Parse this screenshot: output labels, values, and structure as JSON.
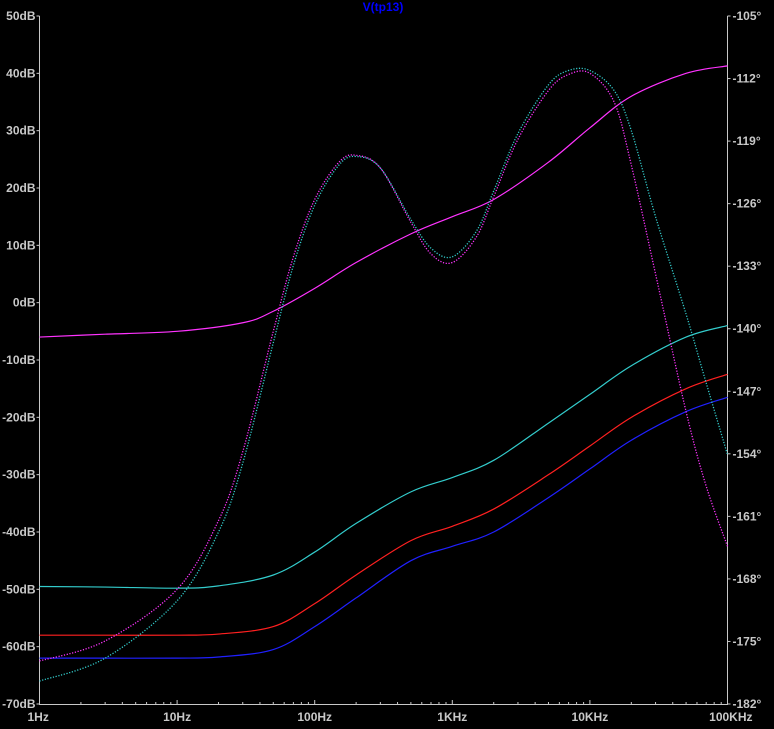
{
  "chart_data": {
    "type": "line",
    "title": "V(tp13)",
    "xscale": "log",
    "xlim": [
      1,
      100000
    ],
    "x_tick_labels": [
      "1Hz",
      "10Hz",
      "100Hz",
      "1KHz",
      "10KHz",
      "100KHz"
    ],
    "ylim_left": [
      -70,
      50
    ],
    "y_left_unit": "dB",
    "y_left_tick_labels": [
      "50dB",
      "40dB",
      "30dB",
      "20dB",
      "10dB",
      "0dB",
      "-10dB",
      "-20dB",
      "-30dB",
      "-40dB",
      "-50dB",
      "-60dB",
      "-70dB"
    ],
    "ylim_right": [
      -182,
      -105
    ],
    "y_right_unit": "degrees",
    "y_right_tick_labels": [
      "-105°",
      "-112°",
      "-119°",
      "-126°",
      "-133°",
      "-140°",
      "-147°",
      "-154°",
      "-161°",
      "-168°",
      "-175°",
      "-182°"
    ],
    "grid": false,
    "background": "#000000",
    "series": [
      {
        "axis": "left",
        "style": "solid",
        "color": "#ff33ff",
        "x": [
          1,
          3,
          10,
          30,
          50,
          100,
          200,
          500,
          1000,
          2000,
          5000,
          10000,
          20000,
          50000,
          100000
        ],
        "y": [
          -6,
          -5.5,
          -5,
          -3.5,
          -1.5,
          2.5,
          7,
          12,
          15,
          18,
          24.5,
          30.5,
          36,
          40,
          41.3
        ]
      },
      {
        "axis": "left",
        "style": "solid",
        "color": "#33cccc",
        "x": [
          1,
          3,
          10,
          20,
          50,
          100,
          200,
          500,
          1000,
          2000,
          5000,
          10000,
          20000,
          50000,
          100000
        ],
        "y": [
          -49.5,
          -49.6,
          -49.8,
          -49.4,
          -47.5,
          -43.5,
          -38.5,
          -33,
          -30.5,
          -27.5,
          -21,
          -16,
          -11,
          -6,
          -4
        ]
      },
      {
        "axis": "left",
        "style": "solid",
        "color": "#ff2020",
        "x": [
          1,
          3,
          10,
          20,
          50,
          100,
          200,
          500,
          1000,
          2000,
          5000,
          10000,
          20000,
          50000,
          100000
        ],
        "y": [
          -58,
          -58,
          -58,
          -57.8,
          -56.5,
          -52.5,
          -47.5,
          -41.5,
          -39,
          -36,
          -30,
          -25,
          -20,
          -15,
          -12.5
        ]
      },
      {
        "axis": "left",
        "style": "solid",
        "color": "#2020ff",
        "x": [
          1,
          3,
          10,
          20,
          50,
          100,
          200,
          500,
          1000,
          2000,
          5000,
          10000,
          20000,
          50000,
          100000
        ],
        "y": [
          -62,
          -62,
          -62,
          -61.8,
          -60.5,
          -56.5,
          -51.5,
          -45,
          -42.5,
          -40,
          -34,
          -29,
          -24,
          -19,
          -16.5
        ]
      },
      {
        "axis": "left",
        "style": "dotted",
        "color": "#ff33ff",
        "x": [
          1,
          3,
          10,
          20,
          30,
          50,
          70,
          100,
          150,
          200,
          300,
          500,
          700,
          1000,
          1500,
          2000,
          3000,
          5000,
          7000,
          10000,
          15000,
          20000,
          30000,
          50000,
          70000,
          100000
        ],
        "y": [
          -62.5,
          -59,
          -50,
          -38,
          -26,
          -5,
          8,
          18,
          24.5,
          25.7,
          23.5,
          14,
          8.5,
          7,
          11.5,
          18.5,
          28.5,
          37,
          39.8,
          40,
          35,
          24,
          5,
          -19,
          -32,
          -42.5
        ]
      },
      {
        "axis": "left",
        "style": "dotted",
        "color": "#33cccc",
        "x": [
          1,
          3,
          10,
          20,
          30,
          50,
          70,
          100,
          150,
          200,
          300,
          500,
          700,
          1000,
          1500,
          2000,
          3000,
          5000,
          7000,
          10000,
          15000,
          20000,
          30000,
          50000,
          70000,
          100000
        ],
        "y": [
          -66,
          -62,
          -52,
          -40,
          -28,
          -7,
          6.5,
          17,
          24,
          25.5,
          23.5,
          14.5,
          9.5,
          8,
          12.5,
          19.5,
          29.5,
          38,
          40.5,
          40.5,
          37,
          30,
          15,
          -2,
          -14,
          -26.5
        ]
      }
    ]
  }
}
